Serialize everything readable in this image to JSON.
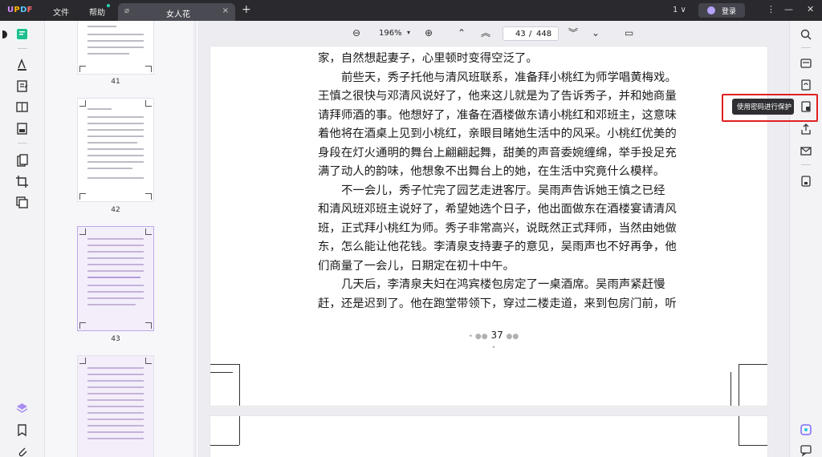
{
  "app": {
    "logo": "UPDF",
    "menus": [
      "文件",
      "帮助"
    ],
    "tab_title": "女人花",
    "tab_close": "×",
    "tab_add": "+",
    "window_count": "1 ∨",
    "login_label": "登录",
    "win_controls": [
      "⋮",
      "—",
      "▢",
      "✕"
    ]
  },
  "toolbar": {
    "zoom": "196%",
    "current_page": "43",
    "page_sep": "/",
    "total_pages": "448"
  },
  "thumbnails": [
    {
      "page": "41"
    },
    {
      "page": "42"
    },
    {
      "page": "43"
    }
  ],
  "document": {
    "lines": [
      {
        "text": "家，自然想起妻子，心里顿时变得空泛了。",
        "indent": false
      },
      {
        "text": "前些天，秀子托他与清风班联系，准备拜小桃红为师学唱黄梅戏。",
        "indent": true
      },
      {
        "text": "王慎之很快与邓清风说好了，他来这儿就是为了告诉秀子，并和她商量",
        "indent": false
      },
      {
        "text": "请拜师酒的事。他想好了，准备在酒楼做东请小桃红和邓班主，这意味",
        "indent": false
      },
      {
        "text": "着他将在酒桌上见到小桃红，亲眼目睹她生活中的风采。小桃红优美的",
        "indent": false
      },
      {
        "text": "身段在灯火通明的舞台上翩翩起舞，甜美的声音委婉缠绵，举手投足充",
        "indent": false
      },
      {
        "text": "满了动人的韵味，他想象不出舞台上的她，在生活中究竟什么模样。",
        "indent": false
      },
      {
        "text": "不一会儿，秀子忙完了园艺走进客厅。吴雨声告诉她王慎之已经",
        "indent": true
      },
      {
        "text": "和清风班邓班主说好了，希望她选个日子，他出面做东在酒楼宴请清风",
        "indent": false
      },
      {
        "text": "班，正式拜小桃红为师。秀子非常高兴，说既然正式拜师，当然由她做",
        "indent": false
      },
      {
        "text": "东，怎么能让他花钱。李清泉支持妻子的意见，吴雨声也不好再争，他",
        "indent": false
      },
      {
        "text": "们商量了一会儿，日期定在初十中午。",
        "indent": false
      },
      {
        "text": "几天后，李清泉夫妇在鸿宾楼包房定了一桌酒席。吴雨声紧赶慢",
        "indent": true
      },
      {
        "text": "赶，还是迟到了。他在跑堂带领下，穿过二楼走道，来到包房门前，听",
        "indent": false
      }
    ],
    "page_number": "37",
    "page_number_dots_left": "• ●●",
    "page_number_dots_right": "●● •"
  },
  "tooltip": {
    "text": "使用密码进行保护"
  },
  "colors": {
    "accent": "#29d3b0",
    "highlight_border": "#e02020",
    "titlebar": "#2a2a2e"
  }
}
